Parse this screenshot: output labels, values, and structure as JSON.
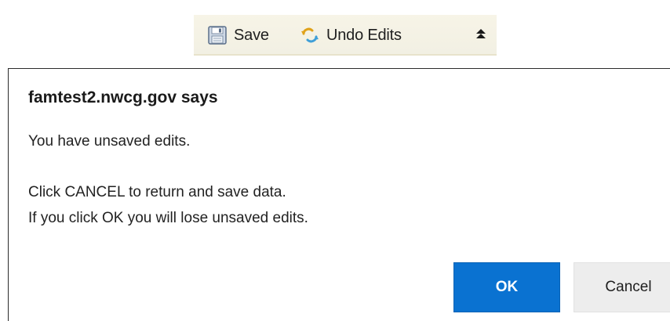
{
  "toolbar": {
    "save_label": "Save",
    "undo_label": "Undo Edits",
    "icons": {
      "save": "floppy-disk-icon",
      "undo": "undo-arrows-icon",
      "collapse": "collapse-up-icon"
    },
    "colors": {
      "background": "#f4f2e6"
    }
  },
  "dialog": {
    "title": "famtest2.nwcg.gov says",
    "line1": "You have unsaved edits.",
    "line2": "Click CANCEL to return and save data.",
    "line3": "If you click OK you will lose unsaved edits.",
    "ok_label": "OK",
    "cancel_label": "Cancel",
    "colors": {
      "ok_bg": "#0a72d1",
      "cancel_bg": "#ededed"
    }
  }
}
